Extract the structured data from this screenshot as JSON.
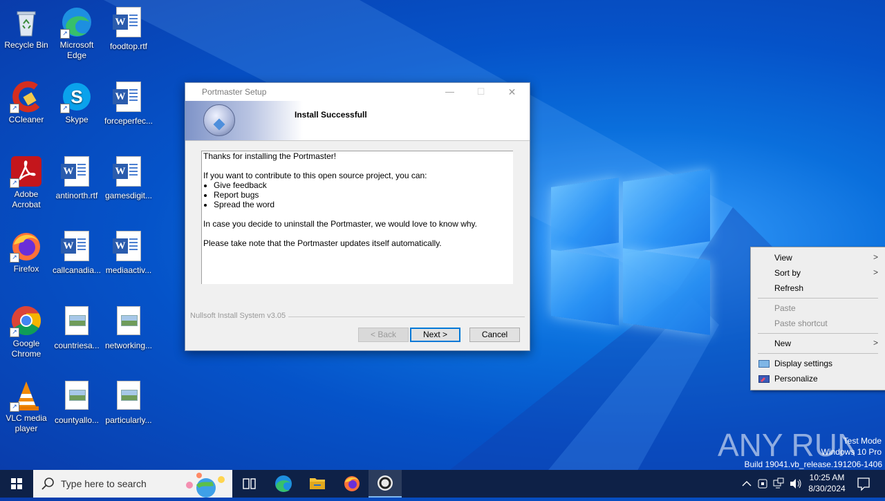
{
  "desktop": {
    "icons": [
      {
        "label": "Recycle Bin"
      },
      {
        "label": "Microsoft Edge"
      },
      {
        "label": "foodtop.rtf"
      },
      {
        "label": "CCleaner"
      },
      {
        "label": "Skype"
      },
      {
        "label": "forceperfec..."
      },
      {
        "label": "Adobe Acrobat"
      },
      {
        "label": "antinorth.rtf"
      },
      {
        "label": "gamesdigit..."
      },
      {
        "label": "Firefox"
      },
      {
        "label": "callcanadia..."
      },
      {
        "label": "mediaactiv..."
      },
      {
        "label": "Google Chrome"
      },
      {
        "label": "countriesa..."
      },
      {
        "label": "networking..."
      },
      {
        "label": "VLC media player"
      },
      {
        "label": "countyallo..."
      },
      {
        "label": "particularly..."
      }
    ]
  },
  "dialog": {
    "title": "Portmaster Setup",
    "header_title": "Install Successfull",
    "minimize": "—",
    "maximize": "☐",
    "close": "✕",
    "body": {
      "line1": "Thanks for installing the Portmaster!",
      "line2": "If you want to contribute to this open source project, you can:",
      "bullets": [
        "Give feedback",
        "Report bugs",
        "Spread the word"
      ],
      "line3": "In case you decide to uninstall the Portmaster, we would love to know why.",
      "line4": "Please take note that the Portmaster updates itself automatically."
    },
    "footer": "Nullsoft Install System v3.05",
    "buttons": {
      "back": "< Back",
      "next": "Next >",
      "cancel": "Cancel"
    }
  },
  "context_menu": {
    "items": [
      {
        "label": "View"
      },
      {
        "label": "Sort by"
      },
      {
        "label": "Refresh"
      },
      {
        "label": "Paste"
      },
      {
        "label": "Paste shortcut"
      },
      {
        "label": "New"
      },
      {
        "label": "Display settings"
      },
      {
        "label": "Personalize"
      }
    ]
  },
  "watermark": {
    "brand": "ANY RUN",
    "line1": "Test Mode",
    "line2": "Windows 10 Pro",
    "line3": "Build 19041.vb_release.191206-1406"
  },
  "taskbar": {
    "search_placeholder": "Type here to search",
    "time": "10:25 AM",
    "date": "8/30/2024"
  }
}
